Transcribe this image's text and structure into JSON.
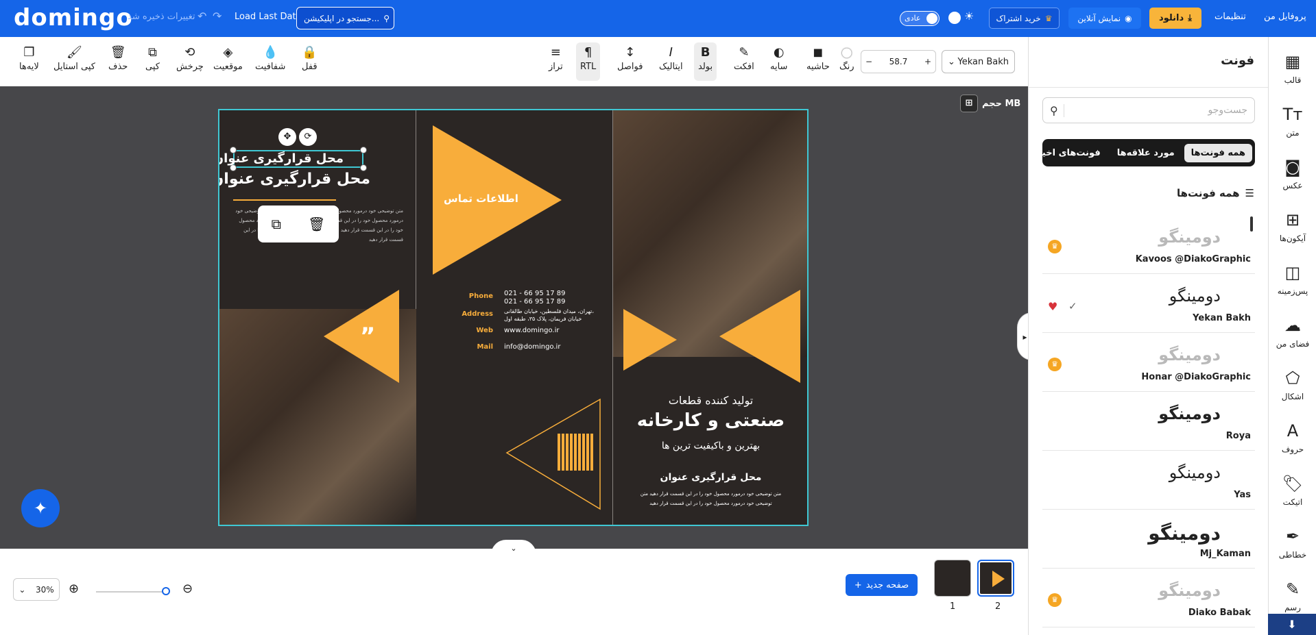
{
  "header": {
    "logo": "domingo",
    "unsaved": "تغییرات ذخیره شد",
    "load_last": "Load Last Data",
    "search_placeholder": "جستجو در اپلیکیشن...",
    "mode_label": "عادی",
    "subscribe": "خرید اشتراک",
    "online": "نمایش آنلاین",
    "download": "دانلود",
    "settings": "تنظیمات",
    "profile": "پروفایل من"
  },
  "toolbar": {
    "font_family": "Yekan Bakh",
    "font_size": "58.7",
    "tools_right": [
      {
        "icon": "●",
        "label": "رنگ"
      },
      {
        "icon": "◼",
        "label": "حاشیه"
      },
      {
        "icon": "◐",
        "label": "سایه"
      },
      {
        "icon": "✎",
        "label": "افکت"
      },
      {
        "icon": "B",
        "label": "بولد"
      },
      {
        "icon": "I",
        "label": "ایتالیک"
      },
      {
        "icon": "↕",
        "label": "فواصل"
      },
      {
        "icon": "¶",
        "label": "RTL"
      },
      {
        "icon": "≡",
        "label": "تراز"
      }
    ],
    "tools_left": [
      {
        "icon": "🔒",
        "label": "قفل"
      },
      {
        "icon": "💧",
        "label": "شفافیت"
      },
      {
        "icon": "◈",
        "label": "موقعیت"
      },
      {
        "icon": "⟲",
        "label": "چرخش"
      },
      {
        "icon": "⧉",
        "label": "کپی"
      },
      {
        "icon": "🗑",
        "label": "حذف"
      },
      {
        "icon": "🖌",
        "label": "کپی استایل"
      },
      {
        "icon": "❐",
        "label": "لایه‌ها"
      }
    ]
  },
  "canvas": {
    "filesize": "حجم MB",
    "panel1": {
      "title_small": "محل قرارگیری عنوان",
      "title_big": "محل قرارگیری عنوان",
      "body": "متن توضیحی خود درمورد محصول خود را در این قسمت قرار دهید متن توضیحی خود درمورد محصول خود را در این قسمت قرار دهید متن توضیحی خود درمورد محصول خود را در این قسمت قرار دهید متن توضیحی خود درمورد محصول خود را در این قسمت قرار دهید",
      "quote": "”"
    },
    "panel2": {
      "contact_title": "اطلاعات تماس",
      "phone_label": "Phone",
      "phone_1": "021 - 66 95 17 89",
      "phone_2": "021 - 66 95 17 89",
      "address_label": "Address",
      "address_1": "تهران، میدان فلسطین، خیابان طالقانی،",
      "address_2": "خیابان فریمان، پلاک ۳۵، طبقه اول",
      "web_label": "Web",
      "web": "www.domingo.ir",
      "mail_label": "Mail",
      "mail": "info@domingo.ir"
    },
    "panel3": {
      "line1": "تولید کننده قطعات",
      "line2": "صنعتی و کارخانه",
      "line3": "بهترین و باکیفیت ترین ها",
      "line4": "محل قرارگیری عنوان",
      "line5": "متن توضیحی خود درمورد محصول خود را در این قسمت قرار دهید متن",
      "line6": "توضیحی خود درمورد محصول خود را در این قسمت قرار دهید"
    }
  },
  "bottom": {
    "zoom": "30%",
    "new_page": "صفحه جدید",
    "pages": [
      "1",
      "2"
    ]
  },
  "sidebar": [
    {
      "icon": "▦",
      "label": "قالب"
    },
    {
      "icon": "Tт",
      "label": "متن"
    },
    {
      "icon": "◙",
      "label": "عکس"
    },
    {
      "icon": "⊞",
      "label": "آیکون‌ها"
    },
    {
      "icon": "◫",
      "label": "پس‌زمینه"
    },
    {
      "icon": "☁",
      "label": "فضای من"
    },
    {
      "icon": "⬠",
      "label": "اشکال"
    },
    {
      "icon": "A",
      "label": "حروف"
    },
    {
      "icon": "🏷",
      "label": "اتیکت"
    },
    {
      "icon": "✒",
      "label": "خطاطی"
    },
    {
      "icon": "✎",
      "label": "رسم"
    }
  ],
  "fonts_panel": {
    "title": "فونت",
    "search_placeholder": "جست‌وجو",
    "tabs": [
      "همه فونت‌ها",
      "مورد علاقه‌ها",
      "فونت‌های اخیر"
    ],
    "all_fonts": "همه فونت‌ها",
    "items": [
      {
        "sample": "دومینگو",
        "name": "Kavoos @DiakoGraphic",
        "premium": true
      },
      {
        "sample": "دومینگو",
        "name": "Yekan Bakh",
        "premium": false,
        "favorite": true,
        "selected": true
      },
      {
        "sample": "دومینگو",
        "name": "Honar @DiakoGraphic",
        "premium": true
      },
      {
        "sample": "دومینگو",
        "name": "Roya",
        "premium": false
      },
      {
        "sample": "دومینگو",
        "name": "Yas",
        "premium": false
      },
      {
        "sample": "دومینگو",
        "name": "Mj_Kaman",
        "premium": false
      },
      {
        "sample": "دومینگو",
        "name": "Diako Babak",
        "premium": true
      }
    ]
  },
  "colors": {
    "brand": "#1565e8",
    "accent": "#f8ad3b",
    "selection": "#3fc8d4"
  }
}
